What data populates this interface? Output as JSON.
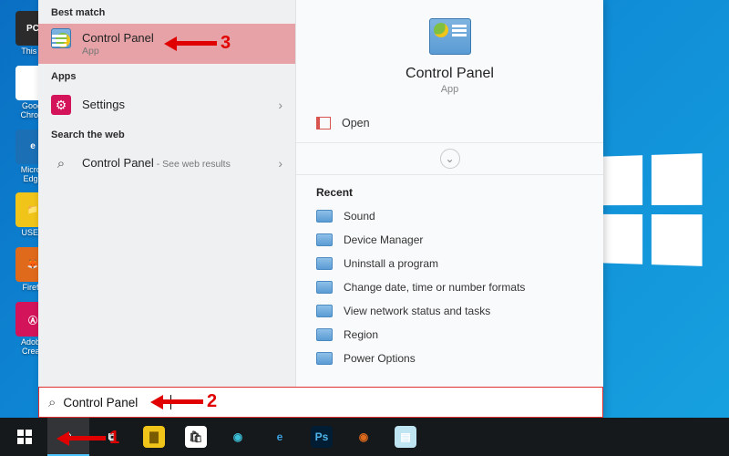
{
  "desktop_icons": [
    {
      "label": "This P",
      "bg": "#2b2b2b",
      "fg": "PC"
    },
    {
      "label": "Googl\nChrom",
      "bg": "#fff",
      "fg": "●"
    },
    {
      "label": "Micros\nEdge",
      "bg": "#1b6fb5",
      "fg": "e"
    },
    {
      "label": "USER",
      "bg": "#f0c419",
      "fg": "📁"
    },
    {
      "label": "Firefo",
      "bg": "#e06a1c",
      "fg": "🦊"
    },
    {
      "label": "Adobe\nCreati",
      "bg": "#d4145a",
      "fg": "Ⓐ"
    }
  ],
  "search": {
    "best_match_label": "Best match",
    "apps_label": "Apps",
    "web_label": "Search the web",
    "results": {
      "cp": {
        "title": "Control Panel",
        "sub": "App"
      },
      "settings": {
        "title": "Settings"
      },
      "web": {
        "title": "Control Panel",
        "hint": " - See web results"
      }
    },
    "query": "Control Panel"
  },
  "detail": {
    "title": "Control Panel",
    "sub": "App",
    "open": "Open",
    "recent_label": "Recent",
    "recent": [
      {
        "label": "Sound"
      },
      {
        "label": "Device Manager"
      },
      {
        "label": "Uninstall a program"
      },
      {
        "label": "Change date, time or number formats"
      },
      {
        "label": "View network status and tasks"
      },
      {
        "label": "Region"
      },
      {
        "label": "Power Options"
      }
    ]
  },
  "annotations": {
    "n1": "1",
    "n2": "2",
    "n3": "3"
  },
  "taskbar_apps": [
    {
      "name": "task-view",
      "bg": "transparent",
      "glyph": "⧉",
      "color": "#fff"
    },
    {
      "name": "file-explorer",
      "bg": "#f0c419",
      "glyph": "▇",
      "color": "#7a5c00"
    },
    {
      "name": "ms-store",
      "bg": "#fff",
      "glyph": "🛍",
      "color": "#333"
    },
    {
      "name": "edge",
      "bg": "transparent",
      "glyph": "◉",
      "color": "#3cc0d8"
    },
    {
      "name": "ie",
      "bg": "transparent",
      "glyph": "e",
      "color": "#3aa0e0"
    },
    {
      "name": "photoshop",
      "bg": "#001d33",
      "glyph": "Ps",
      "color": "#4fb4e8"
    },
    {
      "name": "firefox",
      "bg": "transparent",
      "glyph": "◉",
      "color": "#e06a1c"
    },
    {
      "name": "notepad",
      "bg": "#bfe4f2",
      "glyph": "▤",
      "color": "#fff"
    }
  ]
}
